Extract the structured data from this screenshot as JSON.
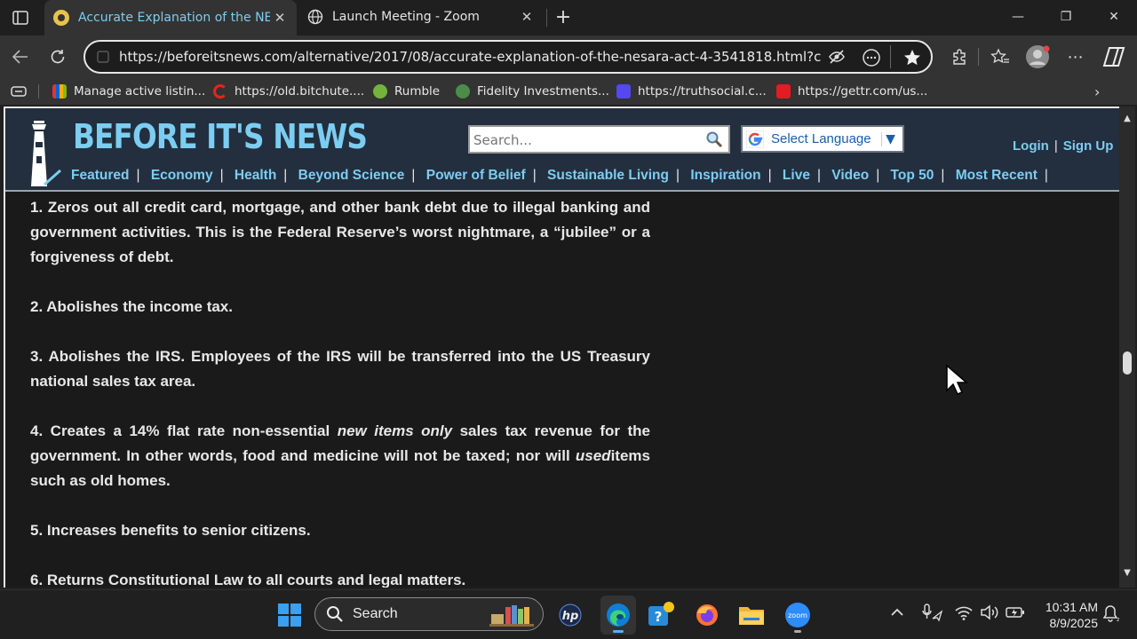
{
  "tabs": [
    {
      "title": "Accurate Explanation of the NESARA Act",
      "close": "✕"
    },
    {
      "title": "Launch Meeting - Zoom",
      "close": "✕"
    }
  ],
  "new_tab": "+",
  "window_controls": {
    "minimize": "—",
    "restore": "❐",
    "close": "✕"
  },
  "address_bar": {
    "url": "https://beforeitsnews.com/alternative/2017/08/accurate-explanation-of-the-nesara-act-4-3541818.html?cu..."
  },
  "bookmarks": [
    {
      "label": "Manage active listin...",
      "color": "#e4b400"
    },
    {
      "label": "https://old.bitchute....",
      "color": "#e8241a"
    },
    {
      "label": "Rumble",
      "color": "#74b43c"
    },
    {
      "label": "Fidelity Investments...",
      "color": "#4c8c4a"
    },
    {
      "label": "https://truthsocial.c...",
      "color": "#5448ee"
    },
    {
      "label": "https://gettr.com/us...",
      "color": "#e01c24"
    }
  ],
  "site": {
    "logo": "BEFORE IT'S NEWS",
    "search_placeholder": "Search...",
    "language_label": "Select Language",
    "language_arrow": "▼",
    "login": "Login",
    "auth_sep": "|",
    "signup": "Sign Up",
    "nav": [
      "Featured",
      "Economy",
      "Health",
      "Beyond Science",
      "Power of Belief",
      "Sustainable Living",
      "Inspiration",
      "Live",
      "Video",
      "Top 50",
      "Most Recent"
    ],
    "nav_sep": "|"
  },
  "article": {
    "p1": "1. Zeros out all credit card, mortgage, and other bank debt due to illegal banking and government activities. This is the Federal Reserve’s worst nightmare, a “jubilee” or a forgiveness of debt.",
    "p2": "2. Abolishes the income tax.",
    "p3": "3. Abolishes the IRS. Employees of the IRS will be transferred into the US Treasury national sales tax area.",
    "p4_a": "4. Creates a 14% flat rate non-essential ",
    "p4_em1": "new items only",
    "p4_b": " sales tax revenue for the government. In other words, food and medicine will not be taxed; nor will ",
    "p4_em2": "used",
    "p4_c": "items such as old homes.",
    "p5": "5. Increases benefits to senior citizens.",
    "p6": "6. Returns Constitutional Law to all courts and legal matters."
  },
  "taskbar": {
    "search_label": "Search",
    "time": "10:31 AM",
    "date": "8/9/2025"
  },
  "colors": {
    "site_header": "#232f3e",
    "link": "#7ccdf2",
    "page_bg": "#1a1a1a"
  }
}
